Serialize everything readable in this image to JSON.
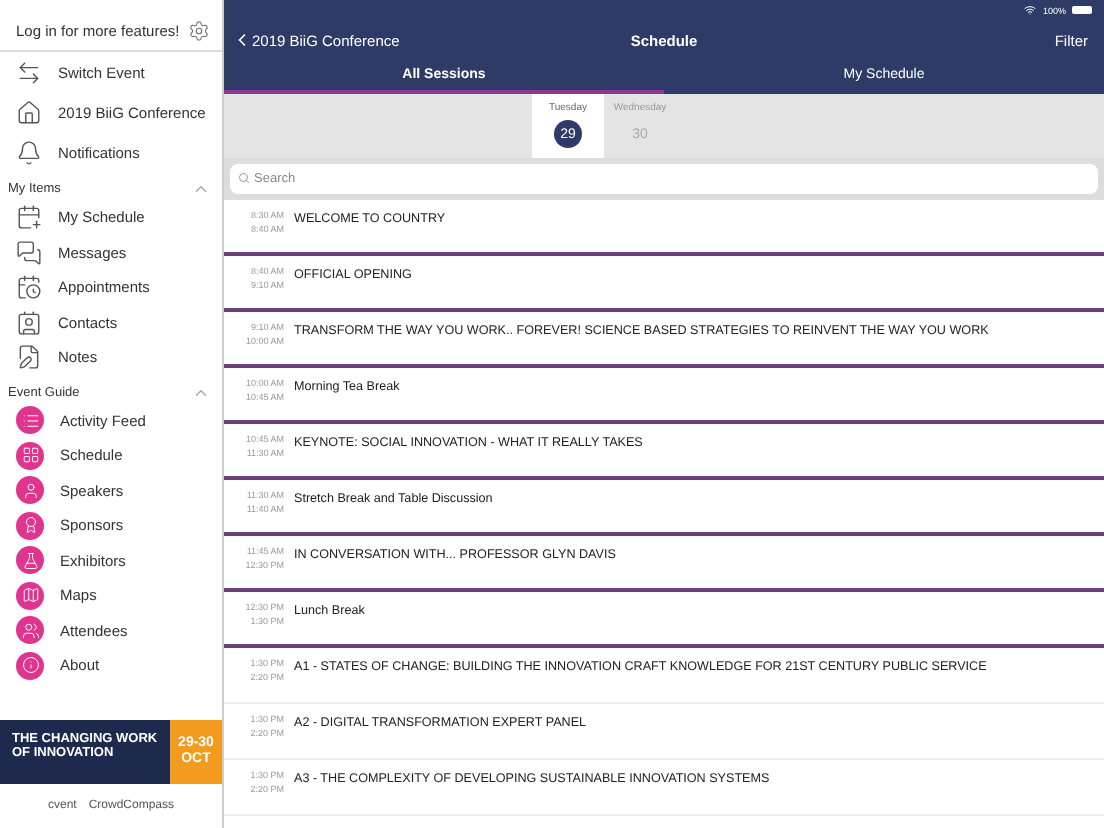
{
  "sidebar": {
    "login_text": "Log in for more features!",
    "top_items": [
      {
        "label": "Switch Event"
      },
      {
        "label": "2019 BiiG Conference"
      },
      {
        "label": "Notifications"
      }
    ],
    "sections": [
      {
        "title": "My Items",
        "expanded": true,
        "items": [
          {
            "label": "My Schedule"
          },
          {
            "label": "Messages"
          },
          {
            "label": "Appointments"
          },
          {
            "label": "Contacts"
          },
          {
            "label": "Notes"
          }
        ]
      },
      {
        "title": "Event Guide",
        "expanded": true,
        "items": [
          {
            "label": "Activity Feed"
          },
          {
            "label": "Schedule"
          },
          {
            "label": "Speakers"
          },
          {
            "label": "Sponsors"
          },
          {
            "label": "Exhibitors"
          },
          {
            "label": "Maps"
          },
          {
            "label": "Attendees"
          },
          {
            "label": "About"
          }
        ]
      }
    ],
    "banner": {
      "headline": "THE CHANGING WORK OF INNOVATION",
      "dates": "29-30",
      "month": "OCT"
    },
    "footer_logos": [
      "cvent",
      "CrowdCompass"
    ]
  },
  "status_bar": {
    "battery": "100%"
  },
  "nav": {
    "back": "2019 BiiG Conference",
    "title": "Schedule",
    "action": "Filter"
  },
  "tabs": [
    {
      "label": "All Sessions",
      "selected": true
    },
    {
      "label": "My Schedule",
      "selected": false
    }
  ],
  "days": [
    {
      "weekday": "Tuesday",
      "date": "29",
      "selected": true
    },
    {
      "weekday": "Wednesday",
      "date": "30",
      "selected": false
    }
  ],
  "search": {
    "placeholder": "Search"
  },
  "sessions": [
    {
      "start": "8:30 AM",
      "end": "8:40 AM",
      "title": "WELCOME TO COUNTRY",
      "kind": "plenary"
    },
    {
      "start": "8:40 AM",
      "end": "9:10 AM",
      "title": "OFFICIAL OPENING",
      "kind": "plenary"
    },
    {
      "start": "9:10 AM",
      "end": "10:00 AM",
      "title": "TRANSFORM THE WAY YOU WORK.. FOREVER! SCIENCE BASED STRATEGIES TO REINVENT THE WAY YOU WORK",
      "kind": "plenary"
    },
    {
      "start": "10:00 AM",
      "end": "10:45 AM",
      "title": "Morning Tea Break",
      "kind": "plenary"
    },
    {
      "start": "10:45 AM",
      "end": "11:30 AM",
      "title": "KEYNOTE: SOCIAL INNOVATION - WHAT IT REALLY TAKES",
      "kind": "plenary"
    },
    {
      "start": "11:30 AM",
      "end": "11:40 AM",
      "title": "Stretch Break and Table Discussion",
      "kind": "plenary"
    },
    {
      "start": "11:45 AM",
      "end": "12:30 PM",
      "title": "IN CONVERSATION WITH... PROFESSOR GLYN DAVIS",
      "kind": "plenary"
    },
    {
      "start": "12:30 PM",
      "end": "1:30 PM",
      "title": "Lunch Break",
      "kind": "plenary"
    },
    {
      "start": "1:30 PM",
      "end": "2:20 PM",
      "title": "A1  - STATES OF CHANGE: BUILDING THE INNOVATION CRAFT KNOWLEDGE FOR 21ST CENTURY PUBLIC SERVICE",
      "kind": "breakout"
    },
    {
      "start": "1:30 PM",
      "end": "2:20 PM",
      "title": "A2 - DIGITAL TRANSFORMATION EXPERT PANEL",
      "kind": "breakout"
    },
    {
      "start": "1:30 PM",
      "end": "2:20 PM",
      "title": "A3 - THE COMPLEXITY OF DEVELOPING SUSTAINABLE INNOVATION SYSTEMS",
      "kind": "breakout"
    }
  ]
}
